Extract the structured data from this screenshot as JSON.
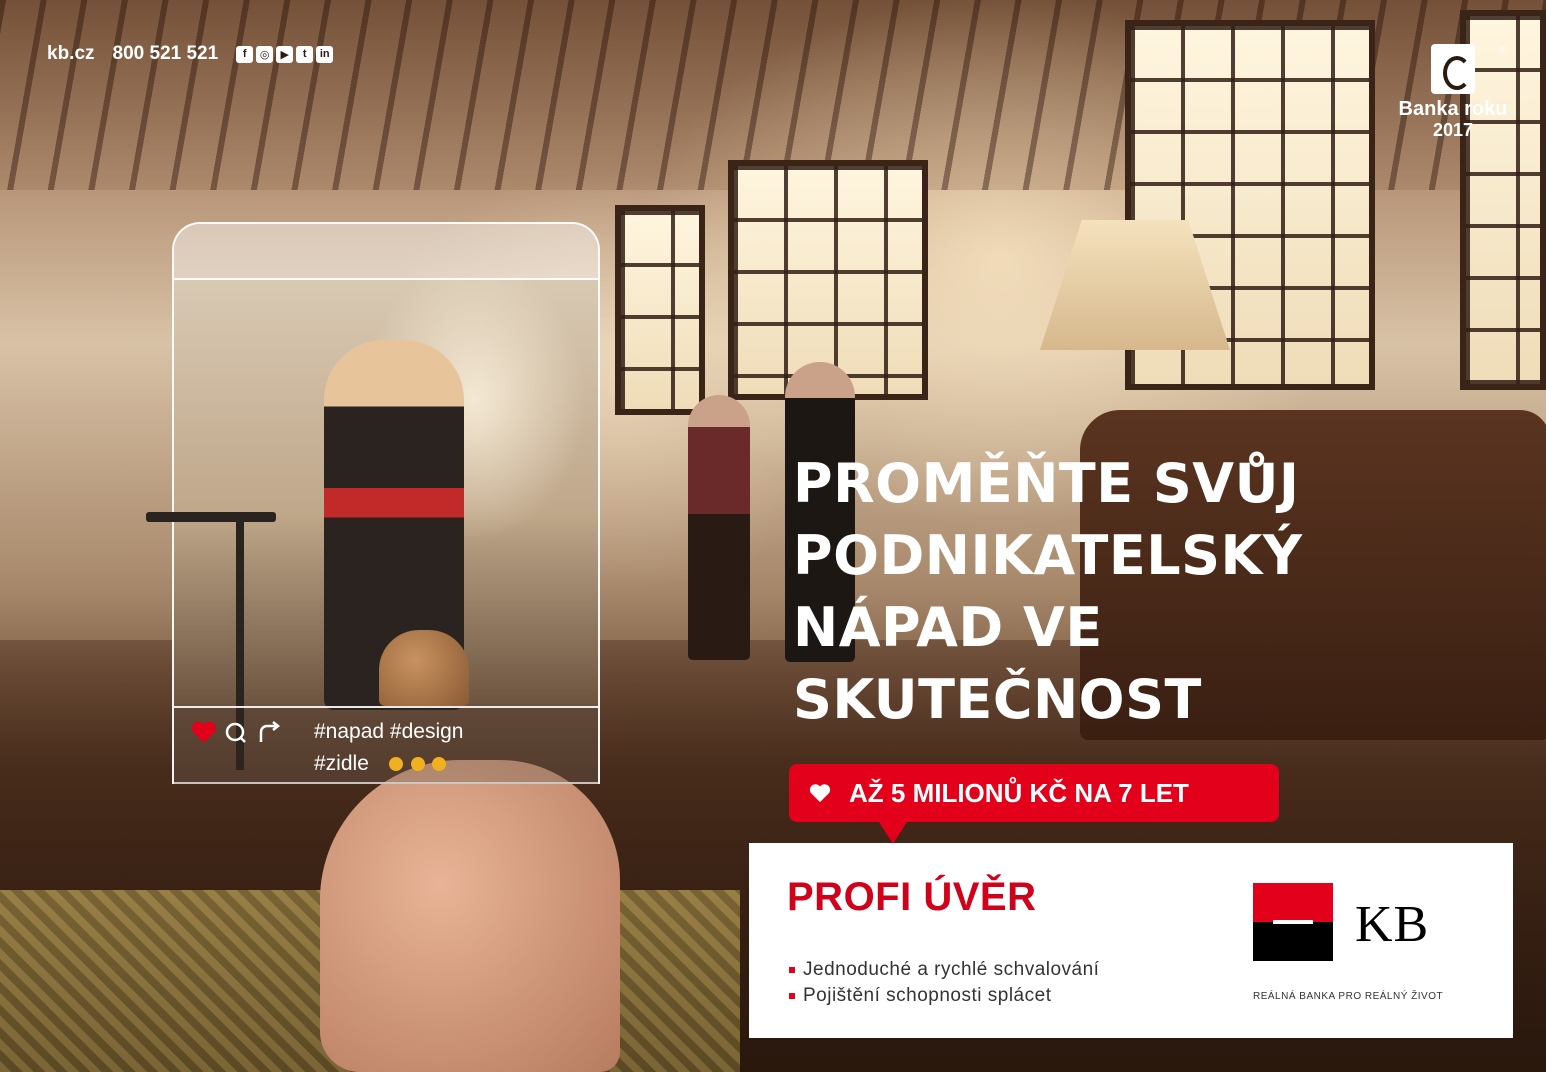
{
  "topbar": {
    "website": "kb.cz",
    "phone": "800 521 521",
    "social": [
      {
        "icon": "facebook-icon",
        "glyph": "f"
      },
      {
        "icon": "instagram-icon",
        "glyph": "◎"
      },
      {
        "icon": "youtube-icon",
        "glyph": "▶"
      },
      {
        "icon": "twitter-icon",
        "glyph": "t"
      },
      {
        "icon": "linkedin-icon",
        "glyph": "in"
      }
    ]
  },
  "award": {
    "line1": "Banka roku",
    "line2": "2017",
    "registered": "®"
  },
  "post": {
    "hashtags_line1": "#napad #design",
    "hashtags_line2": "#zidle",
    "like_color": "#e2001a"
  },
  "headline": {
    "line1": "PROMĚŇTE SVŮJ",
    "line2": "PODNIKATELSKÝ",
    "line3": "NÁPAD VE",
    "line4": "SKUTEČNOST"
  },
  "badge": {
    "text": "AŽ 5 MILIONŮ KČ NA 7 LET",
    "color": "#e2001a"
  },
  "product": {
    "name": "PROFI ÚVĚR",
    "features": [
      "Jednoduché a rychlé schvalování",
      "Pojištění schopnosti splácet"
    ]
  },
  "brand": {
    "logo_text": "KB",
    "tagline": "REÁLNÁ BANKA PRO REÁLNÝ ŽIVOT",
    "red": "#e2001a",
    "black": "#000000"
  }
}
